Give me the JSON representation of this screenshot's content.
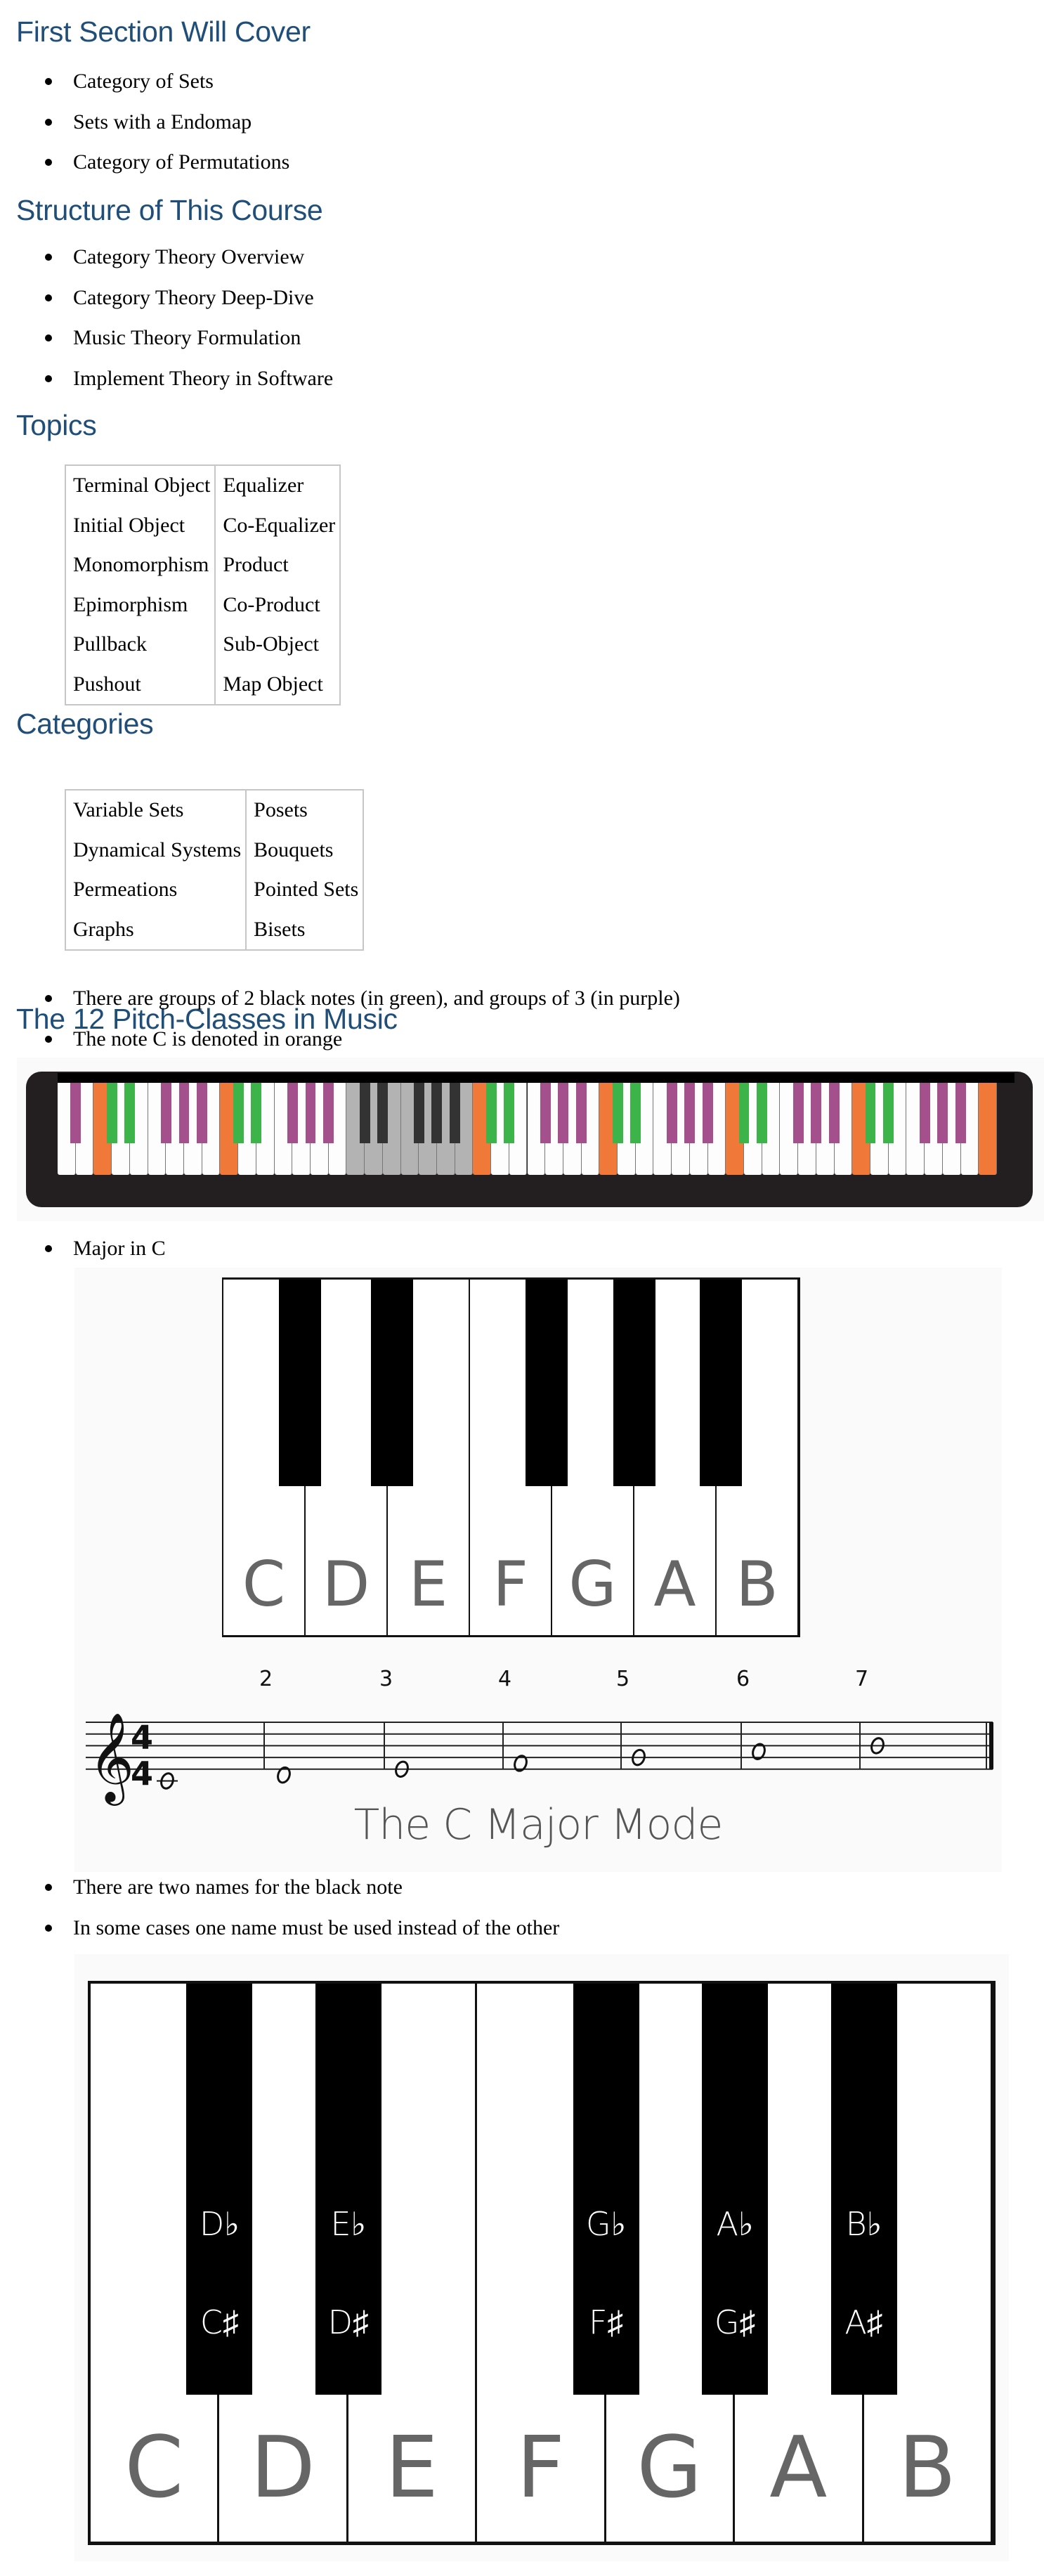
{
  "sections": [
    {
      "title": "First Section Will Cover",
      "bullets": [
        "Category of Sets",
        "Sets with a Endomap",
        "Category of Permutations"
      ]
    },
    {
      "title": "Structure of This Course",
      "bullets": [
        "Category Theory Overview",
        "Category Theory Deep-Dive",
        "Music Theory Formulation",
        "Implement Theory in Software"
      ]
    },
    {
      "title": "Topics",
      "table": [
        [
          "Terminal Object",
          "Equalizer"
        ],
        [
          "Initial Object",
          "Co-Equalizer"
        ],
        [
          "Monomorphism",
          "Product"
        ],
        [
          "Epimorphism",
          "Co-Product"
        ],
        [
          "Pullback",
          "Sub-Object"
        ],
        [
          "Pushout",
          "Map Object"
        ]
      ]
    },
    {
      "title": "Categories",
      "table": [
        [
          "Variable Sets",
          "Posets"
        ],
        [
          "Dynamical Systems",
          "Bouquets"
        ],
        [
          "Permeations",
          "Pointed Sets"
        ],
        [
          "Graphs",
          "Bisets"
        ]
      ]
    },
    {
      "title": "The 12 Pitch-Classes in Music",
      "bullets": [
        "There are groups of 2 black notes (in green), and groups of 3 (in purple)",
        "The note C is denoted in orange"
      ]
    }
  ],
  "bullets_after_keyboard": [
    "Major in C"
  ],
  "bullets_after_mode": [
    "There are two names for the black note",
    "In some cases one name must be used instead of the other"
  ],
  "keyboard_colors": {
    "c_note": "#f07838",
    "two_group": "#3cb44a",
    "three_group": "#a4508c",
    "highlight_octave_white": "#b3b3b3",
    "highlight_octave_black": "#333333",
    "body": "#231f20"
  },
  "keyboard": {
    "first_white_note": "A",
    "white_key_count": 52,
    "highlighted_octave_index": 3
  },
  "c_major": {
    "notes": [
      "C",
      "D",
      "E",
      "F",
      "G",
      "A",
      "B"
    ],
    "measure_numbers": [
      "2",
      "3",
      "4",
      "5",
      "6",
      "7"
    ],
    "time_signature": {
      "top": "4",
      "bottom": "4"
    },
    "clef": "treble",
    "caption": "The C Major Mode"
  },
  "enharmonic": {
    "white_notes": [
      "C",
      "D",
      "E",
      "F",
      "G",
      "A",
      "B"
    ],
    "black_keys": [
      {
        "flat": "D♭",
        "sharp": "C♯"
      },
      {
        "flat": "E♭",
        "sharp": "D♯"
      },
      {
        "flat": "G♭",
        "sharp": "F♯"
      },
      {
        "flat": "A♭",
        "sharp": "G♯"
      },
      {
        "flat": "B♭",
        "sharp": "A♯"
      }
    ]
  }
}
